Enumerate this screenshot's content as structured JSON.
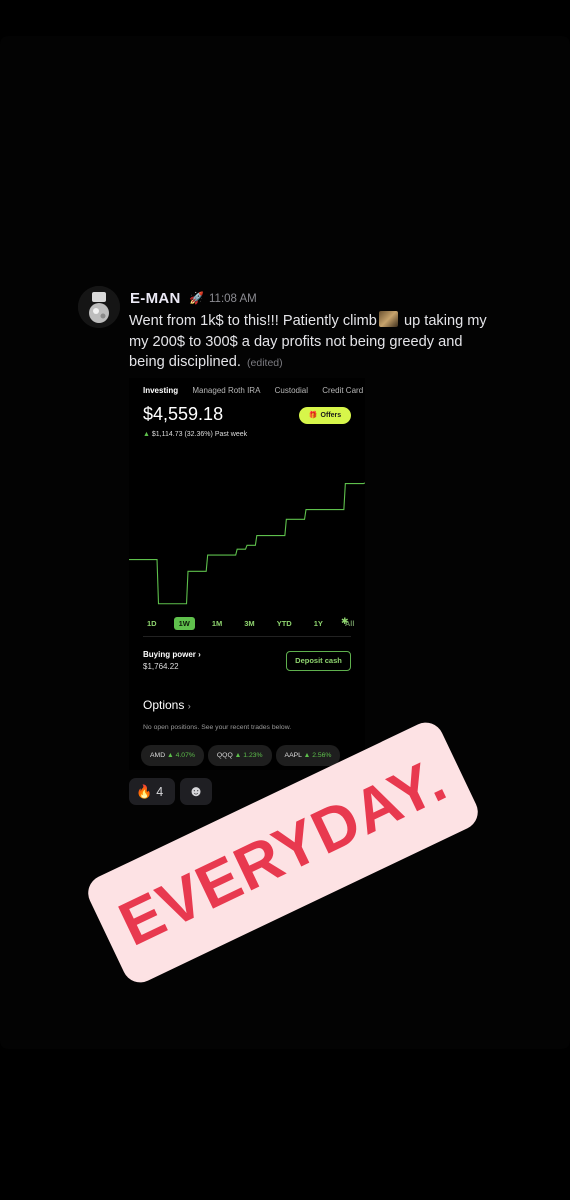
{
  "message": {
    "username": "E-MAN",
    "timestamp": "11:08 AM",
    "text_part1": "Went from 1k$ to this!!! Patiently climb",
    "text_part2": " up taking my my 200$ to 300$ a day profits not being greedy and being disciplined.",
    "edited_label": "(edited)",
    "badge_icon": "rocket-badge-icon",
    "name_color": "#eceaf6"
  },
  "embed": {
    "tabs": [
      "Investing",
      "Managed Roth IRA",
      "Custodial",
      "Credit Card"
    ],
    "active_tab": "Investing",
    "balance": "$4,559.18",
    "offers_label": "Offers",
    "change_arrow": "▲",
    "change_value": "$1,114.73 (32.36%)",
    "change_period": "Past week",
    "ranges": [
      "1D",
      "1W",
      "1M",
      "3M",
      "YTD",
      "1Y",
      "All"
    ],
    "selected_range": "1W",
    "buying_power_label": "Buying power",
    "buying_power_value": "$1,764.22",
    "deposit_label": "Deposit cash",
    "options_title": "Options",
    "options_note": "No open positions. See your recent trades below.",
    "chips": [
      {
        "ticker": "AMD",
        "change": "▲ 4.07%"
      },
      {
        "ticker": "QQQ",
        "change": "▲ 1.23%"
      },
      {
        "ticker": "AAPL",
        "change": "▲ 2.56%"
      }
    ],
    "accent_color": "#5ec04c",
    "offers_color": "#d7f64a"
  },
  "chart_data": {
    "type": "line",
    "x": [
      0,
      1,
      2,
      3,
      4,
      5,
      6,
      7,
      8,
      9,
      10,
      11,
      12,
      13,
      14,
      15,
      16,
      17,
      18,
      19,
      20,
      21,
      22,
      23,
      24
    ],
    "values": [
      3380,
      3380,
      3380,
      2700,
      2700,
      2700,
      3200,
      3200,
      3450,
      3450,
      3450,
      3540,
      3600,
      3750,
      3750,
      3750,
      4000,
      4000,
      4150,
      4150,
      4150,
      4150,
      4550,
      4550,
      4559
    ],
    "color": "#5ec04c"
  },
  "reactions": [
    {
      "emoji": "🔥",
      "count": "4"
    },
    {
      "emoji": "☻",
      "count": ""
    }
  ],
  "sticker": {
    "text": "EVERYDAY.",
    "bg_color": "#fde2e4",
    "text_color": "#e8394f"
  }
}
